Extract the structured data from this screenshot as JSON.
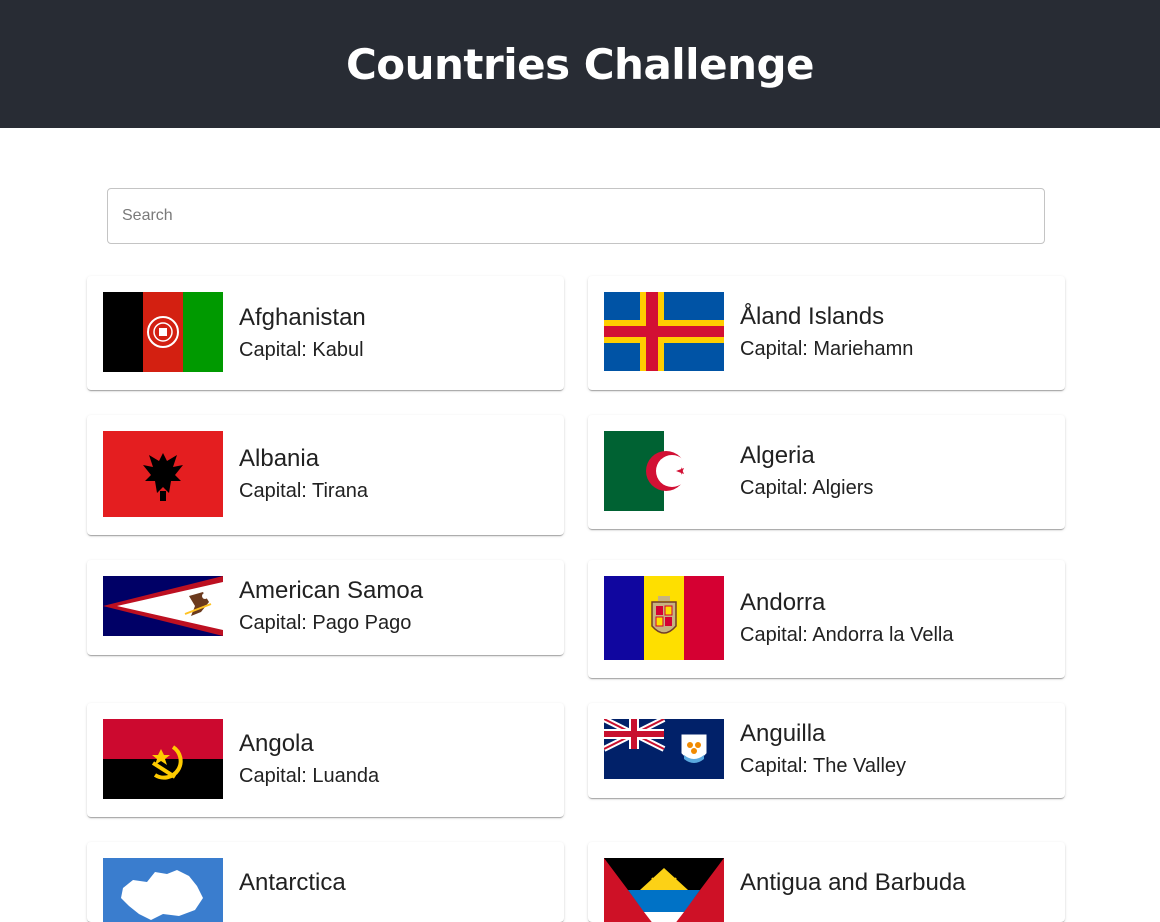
{
  "header": {
    "title": "Countries Challenge"
  },
  "search": {
    "placeholder": "Search",
    "value": ""
  },
  "colors": {
    "header_bg": "#282c34",
    "card_bg": "#ffffff"
  },
  "countries": [
    {
      "name": "Afghanistan",
      "capital": "Capital: Kabul",
      "flag_icon": "afghanistan-flag-icon"
    },
    {
      "name": "Åland Islands",
      "capital": "Capital: Mariehamn",
      "flag_icon": "aland-islands-flag-icon"
    },
    {
      "name": "Albania",
      "capital": "Capital: Tirana",
      "flag_icon": "albania-flag-icon"
    },
    {
      "name": "Algeria",
      "capital": "Capital: Algiers",
      "flag_icon": "algeria-flag-icon"
    },
    {
      "name": "American Samoa",
      "capital": "Capital: Pago Pago",
      "flag_icon": "american-samoa-flag-icon"
    },
    {
      "name": "Andorra",
      "capital": "Capital: Andorra la Vella",
      "flag_icon": "andorra-flag-icon"
    },
    {
      "name": "Angola",
      "capital": "Capital: Luanda",
      "flag_icon": "angola-flag-icon"
    },
    {
      "name": "Anguilla",
      "capital": "Capital: The Valley",
      "flag_icon": "anguilla-flag-icon"
    },
    {
      "name": "Antarctica",
      "capital": "",
      "flag_icon": "antarctica-flag-icon"
    },
    {
      "name": "Antigua and Barbuda",
      "capital": "",
      "flag_icon": "antigua-and-barbuda-flag-icon"
    }
  ]
}
